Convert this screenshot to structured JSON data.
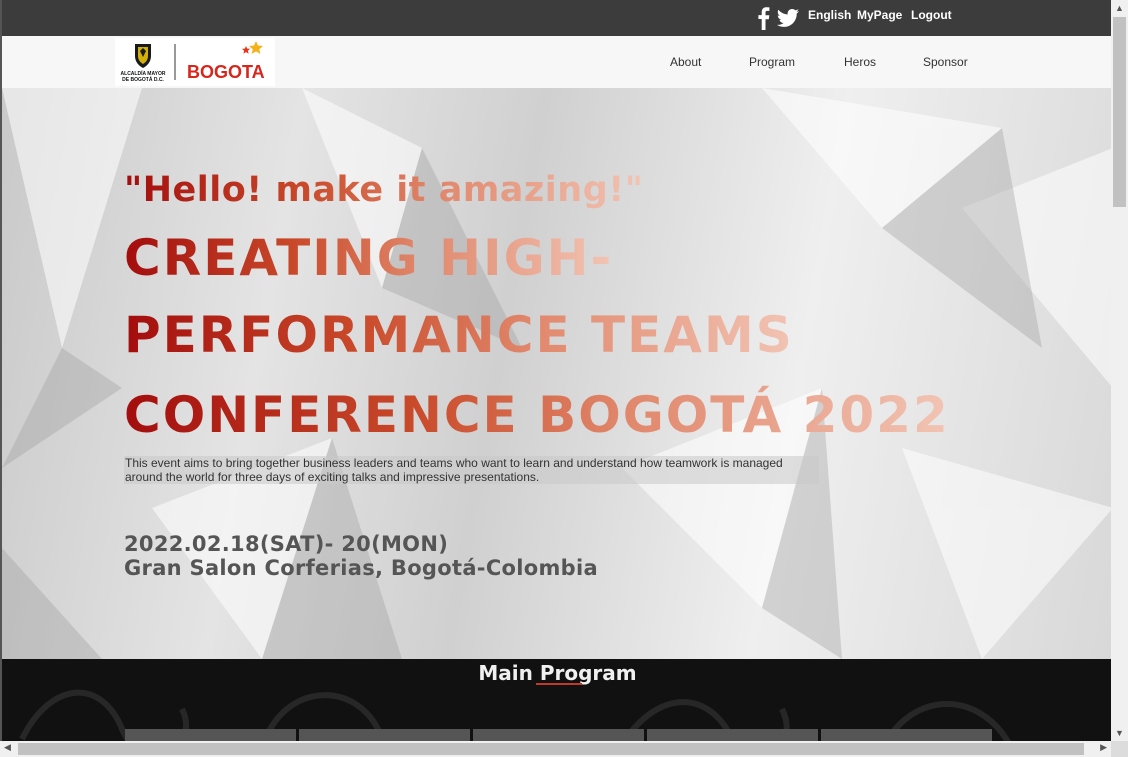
{
  "topbar": {
    "links": {
      "english": "English",
      "mypage": "MyPage",
      "logout": "Logout"
    },
    "icons": [
      "facebook-icon",
      "twitter-icon"
    ]
  },
  "logo": {
    "org_text_1": "ALCALDÍA MAYOR",
    "org_text_2": "DE BOGOTÁ D.C.",
    "brand": "BOGOTA"
  },
  "nav": {
    "about": "About",
    "program": "Program",
    "heros": "Heros",
    "sponsor": "Sponsor"
  },
  "hero": {
    "tagline": "\"Hello! make it amazing!\"",
    "title_lines": [
      "CREATING HIGH-",
      "PERFORMANCE TEAMS",
      "CONFERENCE BOGOTÁ 2022"
    ],
    "description_line_1": "This event aims to bring together business leaders and teams who want to learn and understand how teamwork is managed",
    "description_line_2": "around the world for three days of exciting talks and impressive presentations.",
    "date": "2022.02.18(SAT)- 20(MON)",
    "venue": "Gran Salon Corferias, Bogotá-Colombia"
  },
  "program": {
    "title": "Main Program"
  },
  "colors": {
    "topbar": "#3c3c3c",
    "accent": "#a30d0d",
    "program_bg": "#111111"
  }
}
